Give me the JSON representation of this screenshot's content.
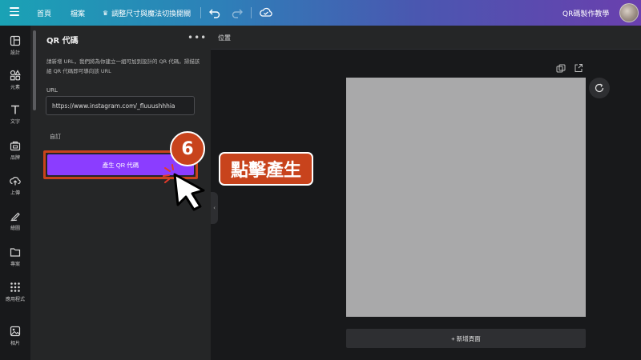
{
  "topbar": {
    "home": "首頁",
    "file": "檔案",
    "resize": "調整尺寸與魔法切換開關",
    "doc_title": "QR碼製作教學",
    "colors": {
      "gradient_start": "#1aa2b5",
      "gradient_end": "#6a3fae"
    }
  },
  "rail": {
    "items": [
      {
        "label": "設計",
        "icon": "layout-icon"
      },
      {
        "label": "元素",
        "icon": "shapes-icon"
      },
      {
        "label": "文字",
        "icon": "text-icon"
      },
      {
        "label": "品牌",
        "icon": "brand-icon"
      },
      {
        "label": "上傳",
        "icon": "upload-cloud-icon"
      },
      {
        "label": "繪圖",
        "icon": "draw-icon"
      },
      {
        "label": "專案",
        "icon": "folder-icon"
      },
      {
        "label": "應用程式",
        "icon": "apps-grid-icon"
      },
      {
        "label": "相片",
        "icon": "photo-icon"
      }
    ]
  },
  "panel": {
    "title": "QR 代碼",
    "more": "•••",
    "description": "請新增 URL，我們將為你建立一組可加到設計的 QR 代碼。掃描該組 QR 代碼即可導向該 URL",
    "url_label": "URL",
    "url_value": "https://www.instagram.com/_fluuushhhia",
    "custom_label": "自訂",
    "generate_button": "產生 QR 代碼",
    "accent": "#8b3dff"
  },
  "canvas": {
    "position_label": "位置",
    "add_page": "+ 新增頁面"
  },
  "overlay": {
    "step_number": "6",
    "callout_text": "點擊產生",
    "color": "#c8431c"
  }
}
